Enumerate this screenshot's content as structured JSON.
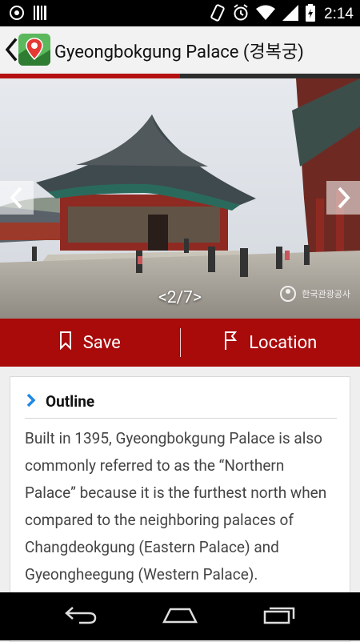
{
  "status_bar": {
    "time": "2:14",
    "left_icons": [
      "settings-notification-icon",
      "barcode-icon"
    ],
    "right_icons": [
      "phone-rotation-icon",
      "alarm-icon",
      "wifi-icon",
      "signal-icon",
      "battery-icon"
    ]
  },
  "header": {
    "title": "Gyeongbokgung Palace (경복궁)",
    "back_icon": "back-chevron-icon",
    "app_icon": "map-pin-app-icon"
  },
  "gallery": {
    "counter": "<2/7>",
    "current_index": 2,
    "total": 7,
    "watermark": "한국관광공사"
  },
  "actions": {
    "save_label": "Save",
    "location_label": "Location"
  },
  "outline": {
    "heading": "Outline",
    "text": "Built in 1395, Gyeongbokgung Palace is also commonly referred to as the “Northern Palace” because it is the furthest north when compared to the neighboring palaces of Changdeokgung (Eastern Palace) and Gyeongheegung (Western Palace)."
  },
  "nav_bar": {
    "icons": [
      "back-icon",
      "home-icon",
      "recent-apps-icon"
    ]
  },
  "colors": {
    "accent_red": "#a90a0a",
    "progress_red": "#b51010"
  }
}
